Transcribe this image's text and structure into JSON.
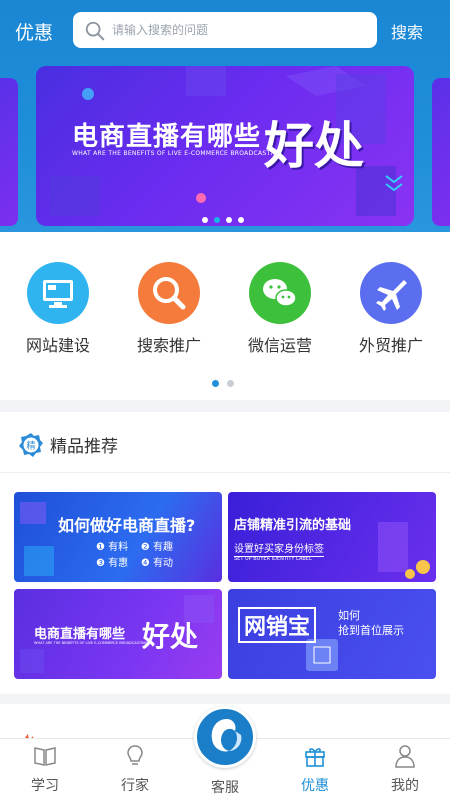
{
  "header": {
    "title": "优惠",
    "search_placeholder": "请输入搜索的问题",
    "search_button": "搜索"
  },
  "banner": {
    "headline": "电商直播有哪些",
    "subline": "WHAT ARE THE BENEFITS OF LIVE E-COMMERCE BROADCASTING",
    "big": "好处",
    "dots": 4,
    "active_dot": 1
  },
  "shortcuts": [
    {
      "label": "网站建设",
      "icon": "monitor-icon",
      "color": "#2fb4ef"
    },
    {
      "label": "搜索推广",
      "icon": "magnifier-icon",
      "color": "#f47b3c"
    },
    {
      "label": "微信运营",
      "icon": "wechat-icon",
      "color": "#3dc13c"
    },
    {
      "label": "外贸推广",
      "icon": "airplane-icon",
      "color": "#5b6ef0"
    }
  ],
  "picks": {
    "title": "精品推荐",
    "badge": "精",
    "cards": [
      {
        "title": "如何做好电商直播?",
        "items": [
          "有料",
          "有趣",
          "有惠",
          "有动"
        ]
      },
      {
        "title": "店铺精准引流的基础",
        "sub": "设置好买家身份标签",
        "sub_en": "SET UP BUYER IDENTITY LABEL"
      },
      {
        "title": "电商直播有哪些",
        "big": "好处",
        "sub_en": "WHAT ARE THE BENEFITS OF LIVE E-COMMERCE BROADCASTING"
      },
      {
        "title": "网销宝",
        "side1": "如何",
        "side2": "抢到首位展示"
      }
    ]
  },
  "tabs": [
    {
      "label": "学习",
      "icon": "book-icon"
    },
    {
      "label": "行家",
      "icon": "lightbulb-icon"
    },
    {
      "label": "客服",
      "icon": "customer-service-icon"
    },
    {
      "label": "优惠",
      "icon": "gift-icon",
      "active": true
    },
    {
      "label": "我的",
      "icon": "user-icon"
    }
  ],
  "colors": {
    "accent": "#2090d8",
    "header": "#1a86d4"
  }
}
